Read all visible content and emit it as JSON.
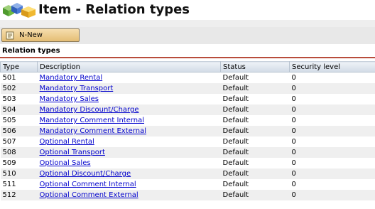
{
  "window": {
    "title": "Item - Relation types"
  },
  "toolbar": {
    "new_label": "N-New"
  },
  "section": {
    "title": "Relation types"
  },
  "table": {
    "columns": [
      "Type",
      "Description",
      "Status",
      "Security level"
    ],
    "rows": [
      [
        "501",
        "Mandatory Rental",
        "Default",
        "0"
      ],
      [
        "502",
        "Mandatory Transport",
        "Default",
        "0"
      ],
      [
        "503",
        "Mandatory Sales",
        "Default",
        "0"
      ],
      [
        "504",
        "Mandatory Discount/Charge",
        "Default",
        "0"
      ],
      [
        "505",
        "Mandatory Comment Internal",
        "Default",
        "0"
      ],
      [
        "506",
        "Mandatory Comment External",
        "Default",
        "0"
      ],
      [
        "507",
        "Optional Rental",
        "Default",
        "0"
      ],
      [
        "508",
        "Optional Transport",
        "Default",
        "0"
      ],
      [
        "509",
        "Optional Sales",
        "Default",
        "0"
      ],
      [
        "510",
        "Optional Discount/Charge",
        "Default",
        "0"
      ],
      [
        "511",
        "Optional Comment Internal",
        "Default",
        "0"
      ],
      [
        "512",
        "Optional Comment External",
        "Default",
        "0"
      ]
    ]
  },
  "colors": {
    "link": "#0000cc",
    "section_rule": "#b84c3c",
    "button": "#e8c585"
  },
  "icons": {
    "logo": "cubes-icon",
    "new_button": "new-document-icon"
  }
}
